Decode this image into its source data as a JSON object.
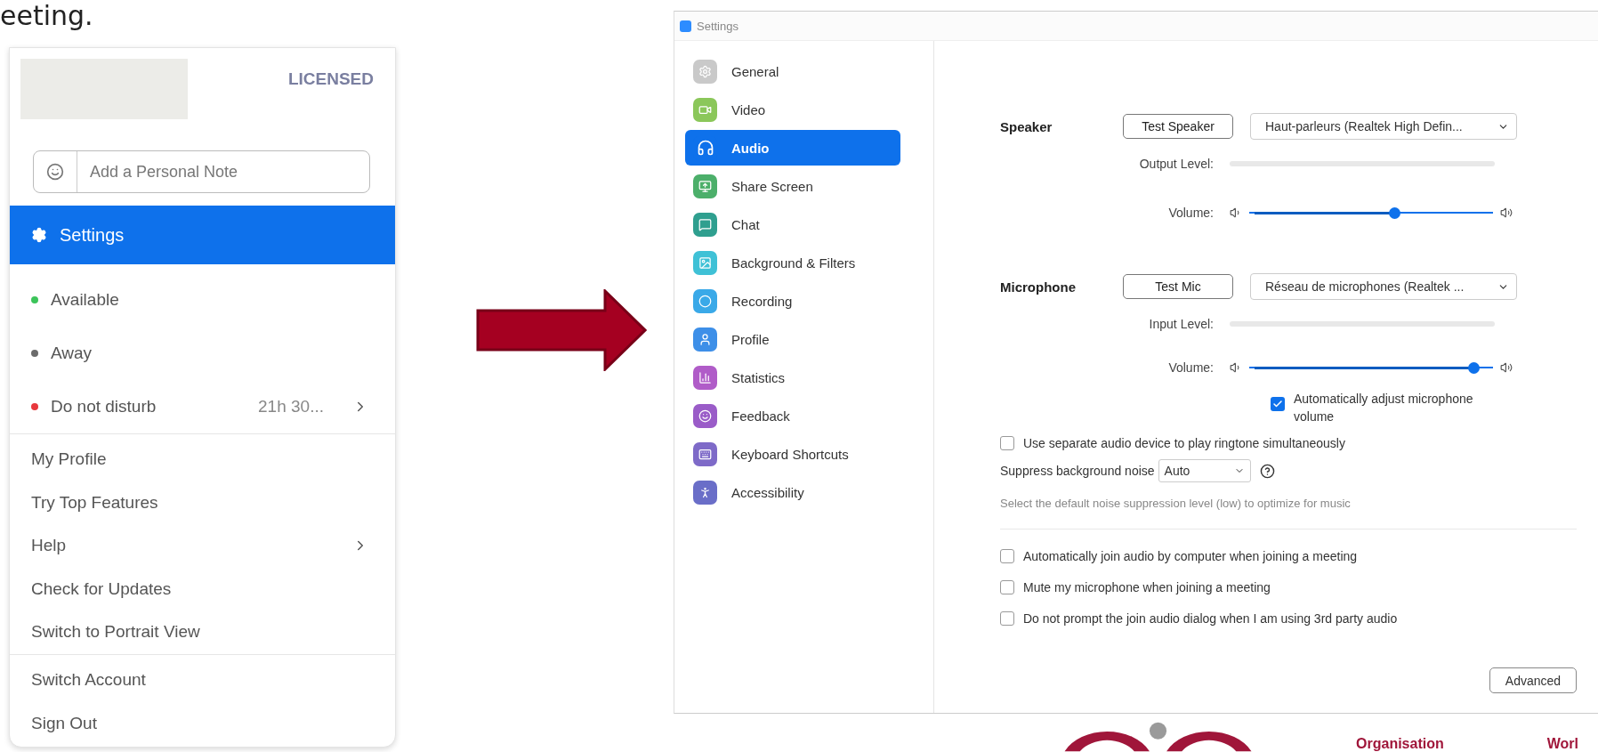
{
  "heading_fragment": "eeting.",
  "profile_menu": {
    "badge": "LICENSED",
    "note_field": {
      "placeholder": "Add a Personal Note"
    },
    "settings_item": {
      "label": "Settings",
      "selected": true
    },
    "statuses": [
      {
        "label": "Available",
        "color": "#3cc45a",
        "submenu": false
      },
      {
        "label": "Away",
        "color": "#6b6b6b",
        "submenu": false
      },
      {
        "label": "Do not disturb",
        "color": "#e8383d",
        "detail": "21h 30...",
        "submenu": true
      }
    ],
    "groups": [
      [
        {
          "label": "My Profile",
          "submenu": false
        },
        {
          "label": "Try Top Features",
          "submenu": false
        },
        {
          "label": "Help",
          "submenu": true
        },
        {
          "label": "Check for Updates",
          "submenu": false
        },
        {
          "label": "Switch to Portrait View",
          "submenu": false
        }
      ],
      [
        {
          "label": "Switch Account",
          "submenu": false
        },
        {
          "label": "Sign Out",
          "submenu": false
        }
      ]
    ]
  },
  "settings_window": {
    "title": "Settings",
    "sidebar": [
      {
        "label": "General",
        "selected": false,
        "color": "#c9c9c9"
      },
      {
        "label": "Video",
        "selected": false,
        "color": "#8bc75a"
      },
      {
        "label": "Audio",
        "selected": true,
        "color": "#0e71eb"
      },
      {
        "label": "Share Screen",
        "selected": false,
        "color": "#4caf6a"
      },
      {
        "label": "Chat",
        "selected": false,
        "color": "#2f9f8f"
      },
      {
        "label": "Background & Filters",
        "selected": false,
        "color": "#3fc1d6"
      },
      {
        "label": "Recording",
        "selected": false,
        "color": "#3aa9e8"
      },
      {
        "label": "Profile",
        "selected": false,
        "color": "#3d8fe8"
      },
      {
        "label": "Statistics",
        "selected": false,
        "color": "#b05cc8"
      },
      {
        "label": "Feedback",
        "selected": false,
        "color": "#9a5cc8"
      },
      {
        "label": "Keyboard Shortcuts",
        "selected": false,
        "color": "#7e6ac8"
      },
      {
        "label": "Accessibility",
        "selected": false,
        "color": "#6a6ec8"
      }
    ],
    "devices": [
      {
        "label": "Speaker",
        "test_button": "Test Speaker",
        "device": "Haut-parleurs (Realtek High Defin...",
        "meter_label": "Output Level:",
        "meter": {
          "level": 0
        },
        "volume_label": "Volume:",
        "volume": {
          "level": 0.6
        }
      },
      {
        "label": "Microphone",
        "test_button": "Test Mic",
        "device": "Réseau de microphones (Realtek ...",
        "meter_label": "Input Level:",
        "meter": {
          "level": 0
        },
        "volume_label": "Volume:",
        "volume": {
          "level": 0.94
        }
      }
    ],
    "auto_adjust": {
      "label": "Automatically adjust microphone volume",
      "checked": true
    },
    "separate_device": {
      "label": "Use separate audio device to play ringtone simultaneously",
      "checked": false
    },
    "suppress": {
      "label": "Suppress background noise",
      "value": "Auto"
    },
    "hint": "Select the default noise suppression level (low) to optimize for music",
    "options": [
      {
        "label": "Automatically join audio by computer when joining a meeting",
        "checked": false
      },
      {
        "label": "Mute my microphone when joining a meeting",
        "checked": false
      },
      {
        "label": "Do not prompt the join audio dialog when I am using 3rd party audio",
        "checked": false
      }
    ],
    "advanced_button": "Advanced"
  },
  "footer": {
    "texts": [
      "Organisation",
      "Worl"
    ]
  }
}
